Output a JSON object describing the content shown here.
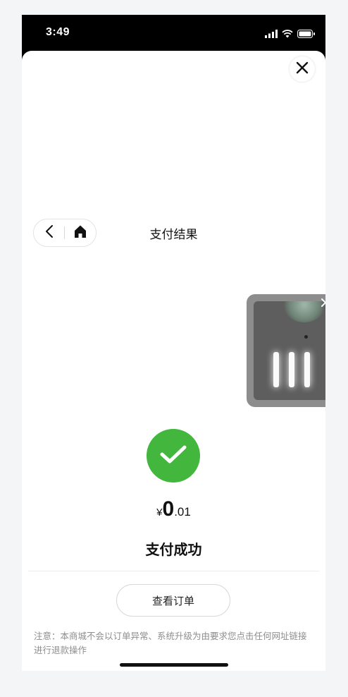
{
  "status_bar": {
    "time": "3:49",
    "icons": [
      "signal-icon",
      "wifi-icon",
      "battery-icon"
    ]
  },
  "header": {
    "title": "支付结果",
    "nav_icons": [
      "back-icon",
      "home-icon"
    ],
    "close_icon": "close-icon"
  },
  "floating_video": {
    "close_icon": "close-icon"
  },
  "result": {
    "icon": "check-icon",
    "icon_color": "#43b73d",
    "currency_symbol": "¥",
    "amount_integer": "0",
    "amount_decimal": ".01",
    "status_text": "支付成功"
  },
  "actions": {
    "view_order_label": "查看订单"
  },
  "notice": {
    "text": "注意：本商城不会以订单异常、系统升级为由要求您点击任何网址链接进行退款操作"
  }
}
